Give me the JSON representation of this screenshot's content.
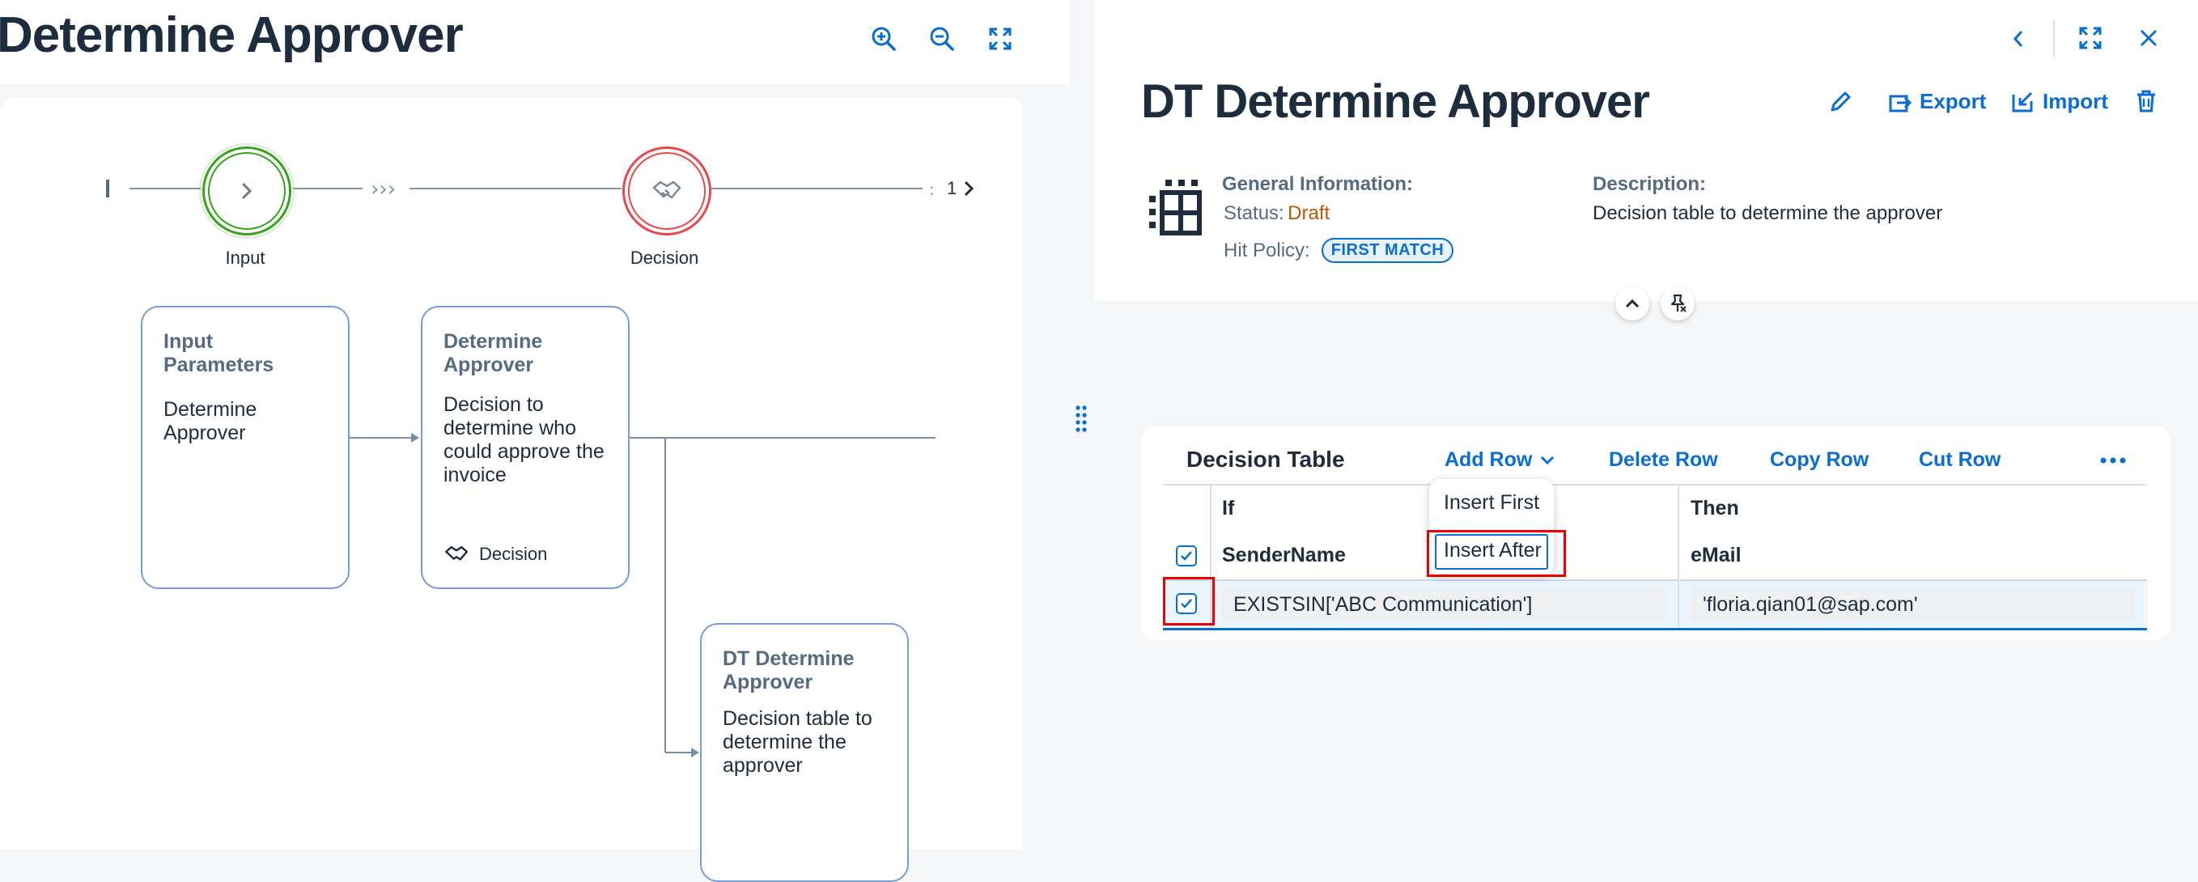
{
  "left": {
    "title": "Determine Approver",
    "flow": {
      "stages": [
        {
          "label": "Input",
          "color": "#36a41d"
        },
        {
          "label": "Decision",
          "color": "#e9484b"
        }
      ],
      "page_number": "1"
    },
    "cards": [
      {
        "title": "Input Parameters",
        "body": "Determine Approver"
      },
      {
        "title": "Determine Approver",
        "body": "Decision to determine who could approve the invoice",
        "footer": "Decision"
      },
      {
        "title": "DT Determine Approver",
        "body": "Decision table to determine the approver"
      }
    ]
  },
  "right": {
    "title": "DT Determine Approver",
    "actions": {
      "export": "Export",
      "import": "Import"
    },
    "general_information": {
      "heading": "General Information:",
      "status_key": "Status:",
      "status_value": "Draft",
      "hit_policy_key": "Hit Policy:",
      "hit_policy_value": "FIRST MATCH"
    },
    "description": {
      "heading": "Description:",
      "text": "Decision table to determine the approver"
    },
    "table": {
      "heading": "Decision Table",
      "toolbar": {
        "add_row": "Add Row",
        "delete_row": "Delete Row",
        "copy_row": "Copy Row",
        "cut_row": "Cut Row"
      },
      "add_row_menu": [
        "Insert First",
        "Insert After"
      ],
      "if_label": "If",
      "then_label": "Then",
      "columns": [
        "SenderName",
        "eMail"
      ],
      "rows": [
        {
          "SenderName": "EXISTSIN['ABC Communication']",
          "eMail": "'floria.qian01@sap.com'",
          "selected": true
        }
      ]
    }
  },
  "colors": {
    "accent": "#0a6ed1",
    "highlight": "#e00000",
    "draft": "#c35500"
  }
}
